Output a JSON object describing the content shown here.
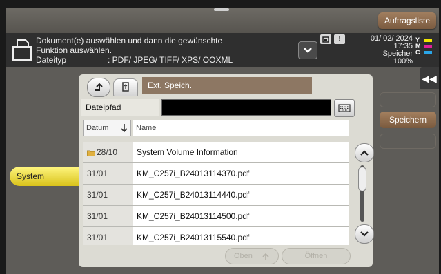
{
  "header": {
    "job_list_label": "Auftragsliste",
    "message_line1": "Dokument(e) auswählen und dann die gewünschte",
    "message_line2": "Funktion auswählen.",
    "filetype_label": "Dateityp",
    "filetype_value": ": PDF/ JPEG/ TIFF/ XPS/ OOXML",
    "date": "01/ 02/ 2024",
    "time": "17:35",
    "memory_label": "Speicher",
    "memory_value": "100%",
    "toner": [
      {
        "label": "Y",
        "color": "#f2e600"
      },
      {
        "label": "M",
        "color": "#e0209a"
      },
      {
        "label": "C",
        "color": "#2aa6e8"
      }
    ]
  },
  "browser": {
    "location_label": "Ext. Speich.",
    "path_label": "Dateipfad",
    "path_value": "",
    "columns": {
      "date": "Datum",
      "name": "Name"
    },
    "files": [
      {
        "date": "28/10",
        "name": "System Volume Information",
        "is_folder": true
      },
      {
        "date": "31/01",
        "name": "KM_C257i_B24013114370.pdf",
        "is_folder": false
      },
      {
        "date": "31/01",
        "name": "KM_C257i_B24013114440.pdf",
        "is_folder": false
      },
      {
        "date": "31/01",
        "name": "KM_C257i_B24013114500.pdf",
        "is_folder": false
      },
      {
        "date": "31/01",
        "name": "KM_C257i_B24013115540.pdf",
        "is_folder": false
      }
    ],
    "oben_label": "Oben",
    "oeffnen_label": "Öffnen"
  },
  "left_tab": {
    "label": "System"
  },
  "right_buttons": {
    "speichern_label": "Speichern"
  },
  "colors": {
    "accent_brown": "#8d7763",
    "system_yellow": "#f0de3a",
    "panel_bg": "#dcdbd3"
  },
  "icons": [
    "document-icon",
    "expand-icon",
    "up-folder-icon",
    "usb-icon",
    "keyboard-icon",
    "sort-down-icon",
    "folder-icon",
    "scroll-up-icon",
    "scroll-down-icon",
    "collapse-icon"
  ]
}
